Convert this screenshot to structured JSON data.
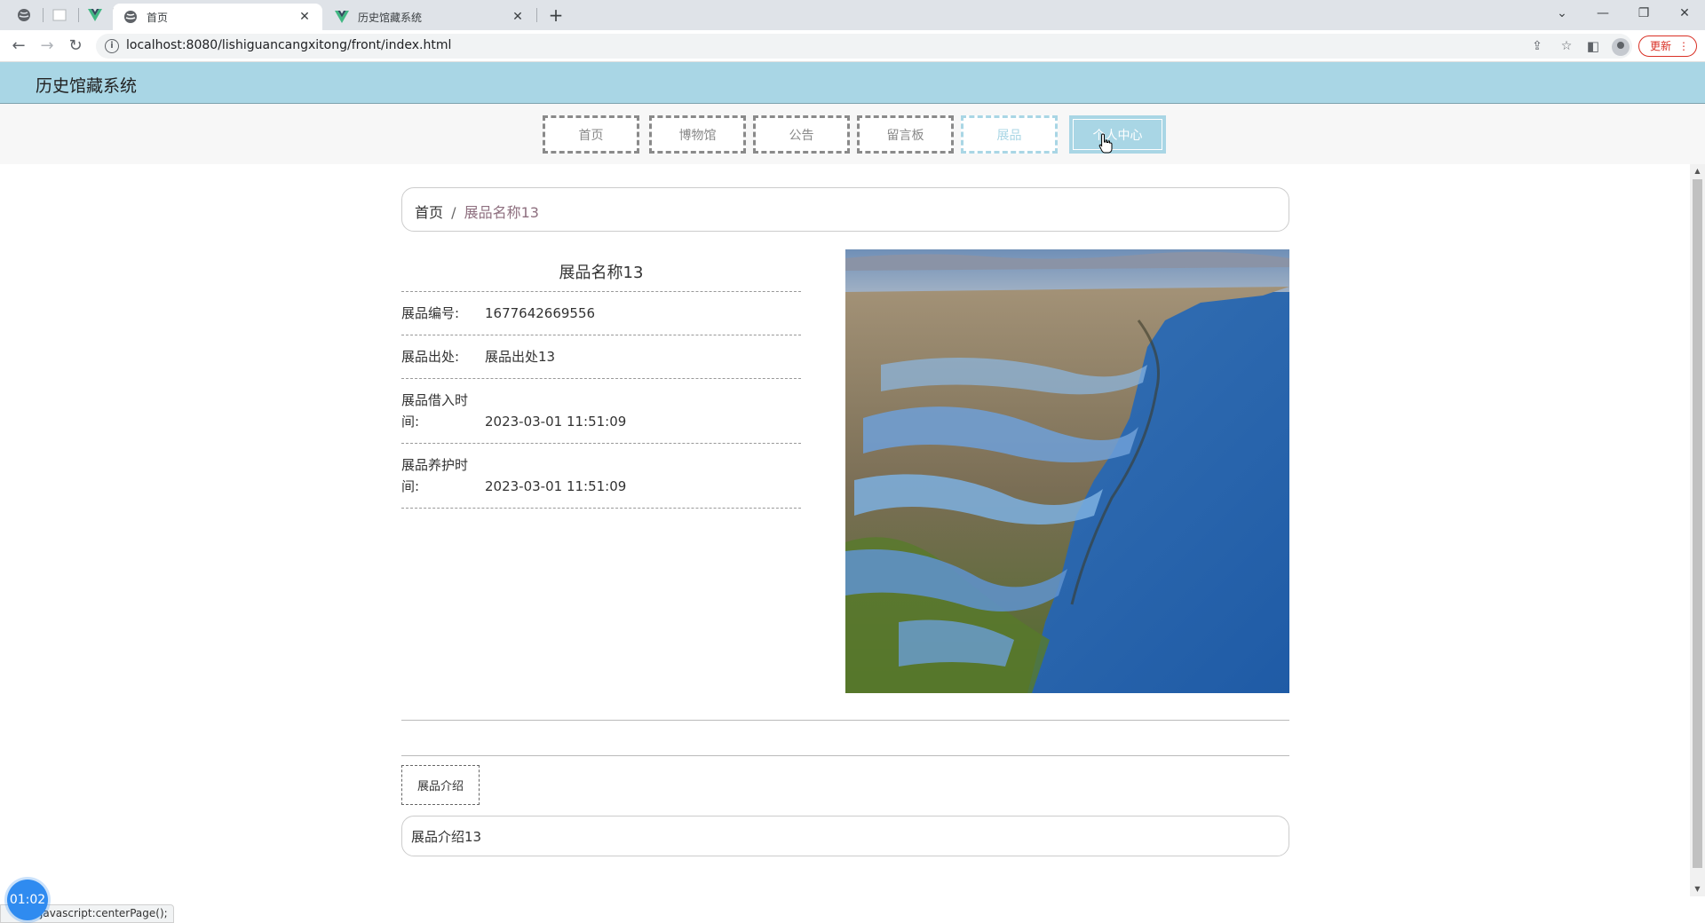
{
  "browser": {
    "tabs": [
      {
        "title": "首页",
        "active": true
      },
      {
        "title": "历史馆藏系统",
        "active": false
      }
    ],
    "url": "localhost:8080/lishiguancangxitong/front/index.html",
    "update_label": "更新",
    "status_url": "javascript:centerPage();"
  },
  "site": {
    "title": "历史馆藏系统",
    "nav": [
      {
        "label": "首页"
      },
      {
        "label": "博物馆"
      },
      {
        "label": "公告"
      },
      {
        "label": "留言板"
      },
      {
        "label": "展品"
      },
      {
        "label": "个人中心"
      }
    ]
  },
  "breadcrumb": {
    "home": "首页",
    "separator": "/",
    "current": "展品名称13"
  },
  "item": {
    "name": "展品名称13",
    "fields": [
      {
        "label": "展品编号:",
        "value": "1677642669556"
      },
      {
        "label": "展品出处:",
        "value": "展品出处13"
      },
      {
        "label": "展品借入时间:",
        "value": "2023-03-01 11:51:09"
      },
      {
        "label": "展品养护时间:",
        "value": "2023-03-01 11:51:09"
      }
    ],
    "intro_tab": "展品介绍",
    "intro_text": "展品介绍13"
  },
  "timer": "01:02",
  "colors": {
    "header_bg": "#a9d6e5",
    "accent": "#a9d6e5",
    "breadcrumb_current": "#8e6f7f"
  }
}
